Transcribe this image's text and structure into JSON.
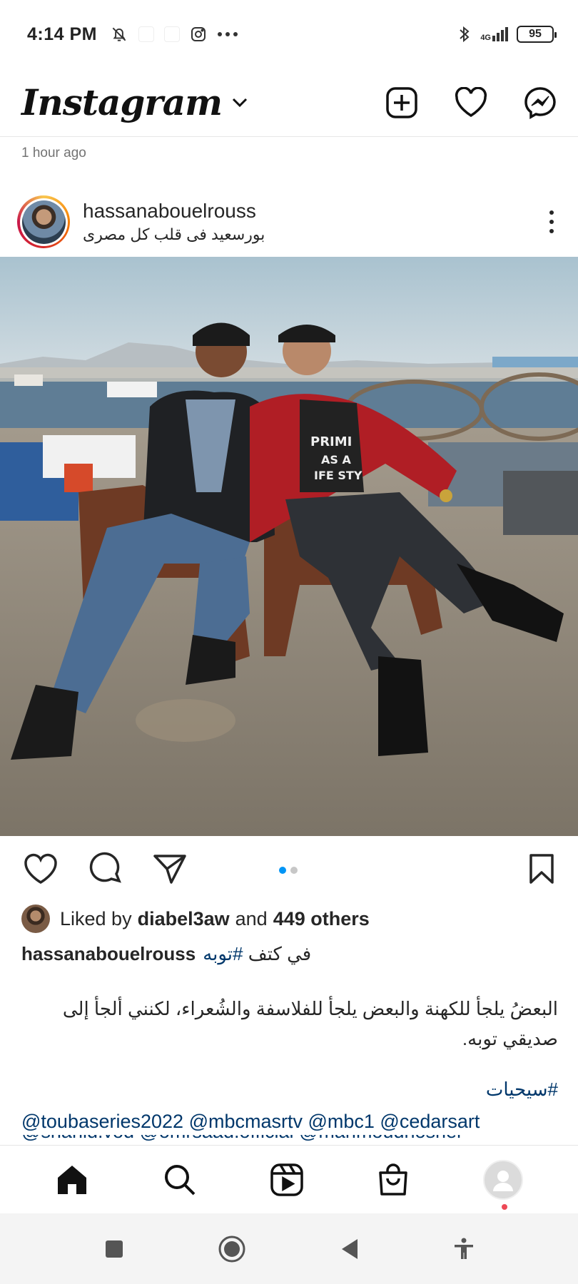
{
  "status_bar": {
    "time": "4:14 PM",
    "network": "4G",
    "battery": "95"
  },
  "header": {
    "logo": "Instagram"
  },
  "feed": {
    "timestamp": "1 hour ago"
  },
  "post": {
    "username": "hassanabouelrouss",
    "location": "بورسعيد فى قلب كل مصرى",
    "carousel": {
      "total": 2,
      "active_index": 0
    },
    "likes": {
      "prefix": "Liked by",
      "liker": "diabel3aw",
      "joiner": "and",
      "others": "449 others"
    },
    "caption": {
      "user": "hassanabouelrouss",
      "first_line_text": "في كتف",
      "first_line_tag": "#توبه",
      "body": "البعضُ يلجأ للكهنة والبعض يلجأ للفلاسفة والشُعراء، لكنني ألجأ إلى صديقي توبه.",
      "tag": "#سيحيات",
      "mentions": "@toubaseries2022 @mbcmasrtv @mbc1 @cedarsart",
      "mentions_cut": "@shahid.vod @omrsaad.official @mahmoudhosher"
    }
  },
  "colors": {
    "link": "#00376b",
    "active_dot": "#0095f6",
    "notification": "#ed4956"
  },
  "icons": {
    "header": [
      "chevron-down-icon",
      "new-post-icon",
      "heart-icon",
      "messenger-icon"
    ],
    "actions": [
      "like-icon",
      "comment-icon",
      "share-icon",
      "save-icon"
    ],
    "nav": [
      "home-icon",
      "search-icon",
      "reels-icon",
      "shop-icon",
      "profile-icon"
    ],
    "system": [
      "recents-icon",
      "home-circle-icon",
      "back-icon",
      "accessibility-icon"
    ]
  }
}
